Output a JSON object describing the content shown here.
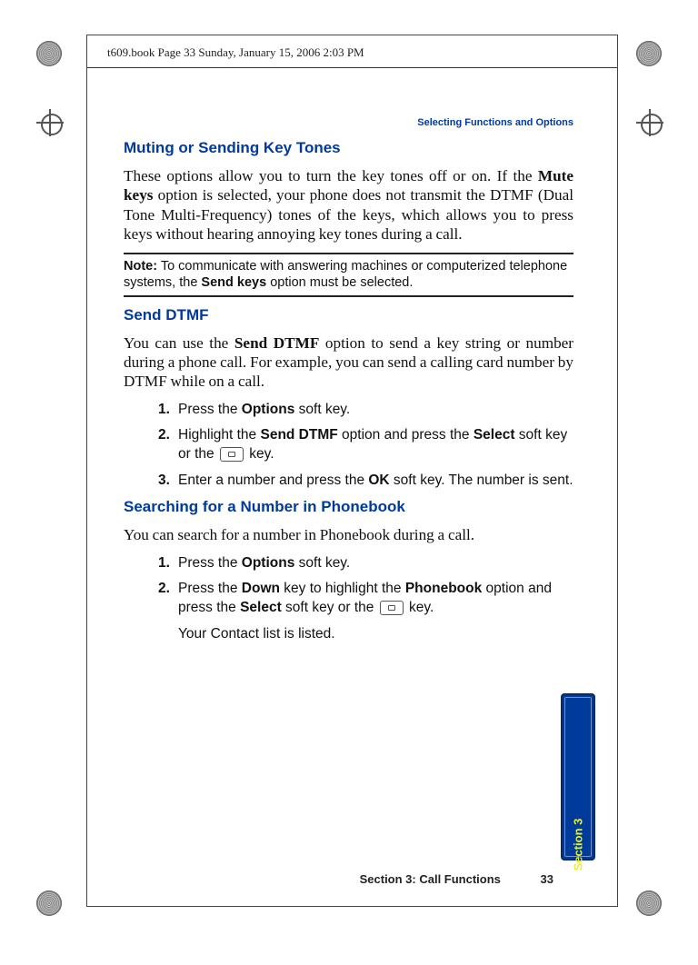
{
  "meta_header": "t609.book  Page 33  Sunday, January 15, 2006  2:03 PM",
  "running_head": "Selecting Functions and Options",
  "h_muting": "Muting or Sending Key Tones",
  "p_muting_1": "These options allow you to turn the key tones off or on. If the ",
  "p_muting_b1": "Mute keys",
  "p_muting_2": " option is selected, your phone does not transmit the DTMF (Dual Tone Multi-Frequency) tones of the keys, which allows you to press keys without hearing annoying key tones during a call.",
  "note_b": "Note:",
  "note_1": " To communicate with answering machines or computerized telephone systems, the ",
  "note_b2": "Send keys",
  "note_2": " option must be selected.",
  "h_senddtmf": "Send DTMF",
  "p_senddtmf_1": "You can use the ",
  "p_senddtmf_b1": "Send DTMF",
  "p_senddtmf_2": " option to send a key string or number during a phone call. For example, you can send a calling card number by DTMF while on a call.",
  "steps_dtmf": {
    "n1": "1.",
    "s1a": "Press the ",
    "s1b": "Options",
    "s1c": " soft key.",
    "n2": "2.",
    "s2a": "Highlight the ",
    "s2b": "Send DTMF",
    "s2c": " option and press the ",
    "s2d": "Select",
    "s2e": " soft key or the ",
    "s2f": " key.",
    "n3": "3.",
    "s3a": "Enter a number and press the ",
    "s3b": "OK",
    "s3c": " soft key. The number is sent."
  },
  "h_search": "Searching for a Number in Phonebook",
  "p_search": "You can search for a number in Phonebook during a call.",
  "steps_pb": {
    "n1": "1.",
    "s1a": "Press the ",
    "s1b": "Options",
    "s1c": " soft key.",
    "n2": "2.",
    "s2a": "Press the ",
    "s2b": "Down",
    "s2c": " key to highlight the ",
    "s2d": "Phonebook",
    "s2e": " option and press the ",
    "s2f": "Select",
    "s2g": " soft key or the ",
    "s2h": " key.",
    "result": "Your Contact list is listed."
  },
  "footer_section": "Section 3: Call Functions",
  "footer_page": "33",
  "side_tab": "Section 3"
}
